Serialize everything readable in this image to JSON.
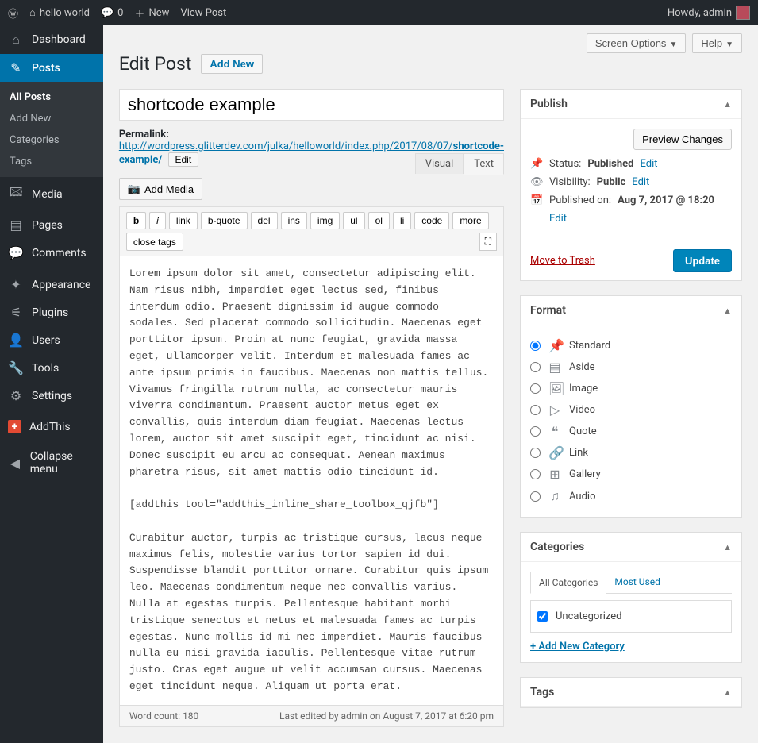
{
  "adminbar": {
    "site": "hello world",
    "comments": "0",
    "new": "New",
    "view": "View Post",
    "howdy": "Howdy, admin"
  },
  "sidebar": [
    {
      "label": "Dashboard",
      "icon": "⌂"
    },
    {
      "label": "Posts",
      "icon": "✎",
      "current": true,
      "sub": [
        {
          "label": "All Posts",
          "current": true
        },
        {
          "label": "Add New"
        },
        {
          "label": "Categories"
        },
        {
          "label": "Tags"
        }
      ]
    },
    {
      "label": "Media",
      "icon": "🖾"
    },
    {
      "label": "Pages",
      "icon": "▤"
    },
    {
      "label": "Comments",
      "icon": "💬"
    },
    {
      "sep": true
    },
    {
      "label": "Appearance",
      "icon": "✦"
    },
    {
      "label": "Plugins",
      "icon": "⚟"
    },
    {
      "label": "Users",
      "icon": "👤"
    },
    {
      "label": "Tools",
      "icon": "🔧"
    },
    {
      "label": "Settings",
      "icon": "⚙"
    },
    {
      "sep": true
    },
    {
      "label": "AddThis",
      "addthis": true
    },
    {
      "sep": true
    },
    {
      "label": "Collapse menu",
      "icon": "◀"
    }
  ],
  "top": {
    "screen": "Screen Options",
    "help": "Help"
  },
  "page": {
    "title": "Edit Post",
    "addnew": "Add New"
  },
  "title_input": "shortcode example",
  "permalink": {
    "label": "Permalink:",
    "base": "http://wordpress.glitterdev.com/julka/helloworld/index.php/2017/08/07/",
    "slug": "shortcode-example/",
    "edit": "Edit"
  },
  "add_media": "Add Media",
  "tabs": {
    "visual": "Visual",
    "text": "Text"
  },
  "quicktags": [
    "b",
    "i",
    "link",
    "b-quote",
    "del",
    "ins",
    "img",
    "ul",
    "ol",
    "li",
    "code",
    "more",
    "close tags"
  ],
  "content": "Lorem ipsum dolor sit amet, consectetur adipiscing elit. Nam risus nibh, imperdiet eget lectus sed, finibus interdum odio. Praesent dignissim id augue commodo sodales. Sed placerat commodo sollicitudin. Maecenas eget porttitor ipsum. Proin at nunc feugiat, gravida massa eget, ullamcorper velit. Interdum et malesuada fames ac ante ipsum primis in faucibus. Maecenas non mattis tellus. Vivamus fringilla rutrum nulla, ac consectetur mauris viverra condimentum. Praesent auctor metus eget ex convallis, quis interdum diam feugiat. Maecenas lectus lorem, auctor sit amet suscipit eget, tincidunt ac nisi. Donec suscipit eu arcu ac consequat. Aenean maximus pharetra risus, sit amet mattis odio tincidunt id.\n\n[addthis tool=\"addthis_inline_share_toolbox_qjfb\"]\n\nCurabitur auctor, turpis ac tristique cursus, lacus neque maximus felis, molestie varius tortor sapien id dui. Suspendisse blandit porttitor ornare. Curabitur quis ipsum leo. Maecenas condimentum neque nec convallis varius. Nulla at egestas turpis. Pellentesque habitant morbi tristique senectus et netus et malesuada fames ac turpis egestas. Nunc mollis id mi nec imperdiet. Mauris faucibus nulla eu nisi gravida iaculis. Pellentesque vitae rutrum justo. Cras eget augue ut velit accumsan cursus. Maecenas eget tincidunt neque. Aliquam ut porta erat.",
  "status": {
    "wordcount": "Word count: 180",
    "lastedit": "Last edited by admin on August 7, 2017 at 6:20 pm"
  },
  "publish": {
    "title": "Publish",
    "preview": "Preview Changes",
    "status_lbl": "Status:",
    "status_val": "Published",
    "status_edit": "Edit",
    "vis_lbl": "Visibility:",
    "vis_val": "Public",
    "vis_edit": "Edit",
    "date_lbl": "Published on:",
    "date_val": "Aug 7, 2017 @ 18:20",
    "date_edit": "Edit",
    "trash": "Move to Trash",
    "update": "Update"
  },
  "format": {
    "title": "Format",
    "options": [
      {
        "label": "Standard",
        "icon": "📌",
        "checked": true
      },
      {
        "label": "Aside",
        "icon": "▤"
      },
      {
        "label": "Image",
        "icon": "🖼"
      },
      {
        "label": "Video",
        "icon": "▷"
      },
      {
        "label": "Quote",
        "icon": "❝"
      },
      {
        "label": "Link",
        "icon": "🔗"
      },
      {
        "label": "Gallery",
        "icon": "⊞"
      },
      {
        "label": "Audio",
        "icon": "♫"
      }
    ]
  },
  "categories": {
    "title": "Categories",
    "tab_all": "All Categories",
    "tab_most": "Most Used",
    "item": "Uncategorized",
    "add": "+ Add New Category"
  },
  "tags": {
    "title": "Tags"
  }
}
